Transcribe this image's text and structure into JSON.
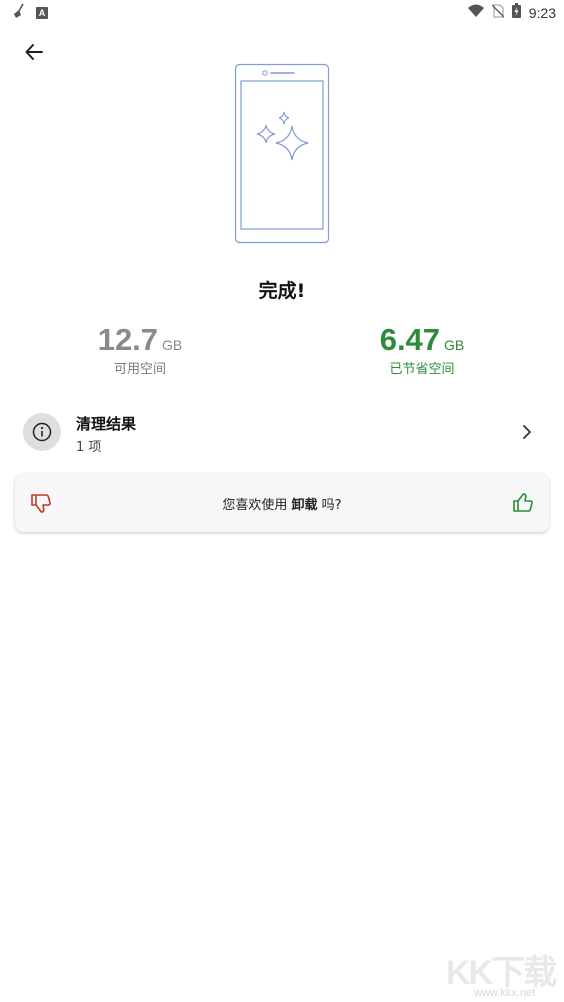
{
  "status_bar": {
    "time": "9:23",
    "left_icons": [
      "broom-icon",
      "a-badge-icon"
    ],
    "right_icons": [
      "wifi-icon",
      "no-sim-icon",
      "battery-icon"
    ],
    "a_badge": "A"
  },
  "back": {
    "icon": "arrow-left-icon"
  },
  "title": "完成!",
  "stats": {
    "free": {
      "value": "12.7",
      "unit": "GB",
      "label": "可用空间",
      "color": "#8a8a8e"
    },
    "saved": {
      "value": "6.47",
      "unit": "GB",
      "label": "已节省空间",
      "color": "#2e8b3a"
    }
  },
  "results": {
    "icon": "info-icon",
    "title": "清理结果",
    "subtitle": "1 项"
  },
  "feedback": {
    "prefix": "您喜欢使用 ",
    "app_name": "卸载",
    "suffix": " 吗?",
    "dislike_icon": "thumbs-down-icon",
    "like_icon": "thumbs-up-icon",
    "dislike_color": "#c0392b",
    "like_color": "#2e8b3a"
  },
  "watermark": {
    "logo": "KK下载",
    "url": "www.kkx.net"
  }
}
